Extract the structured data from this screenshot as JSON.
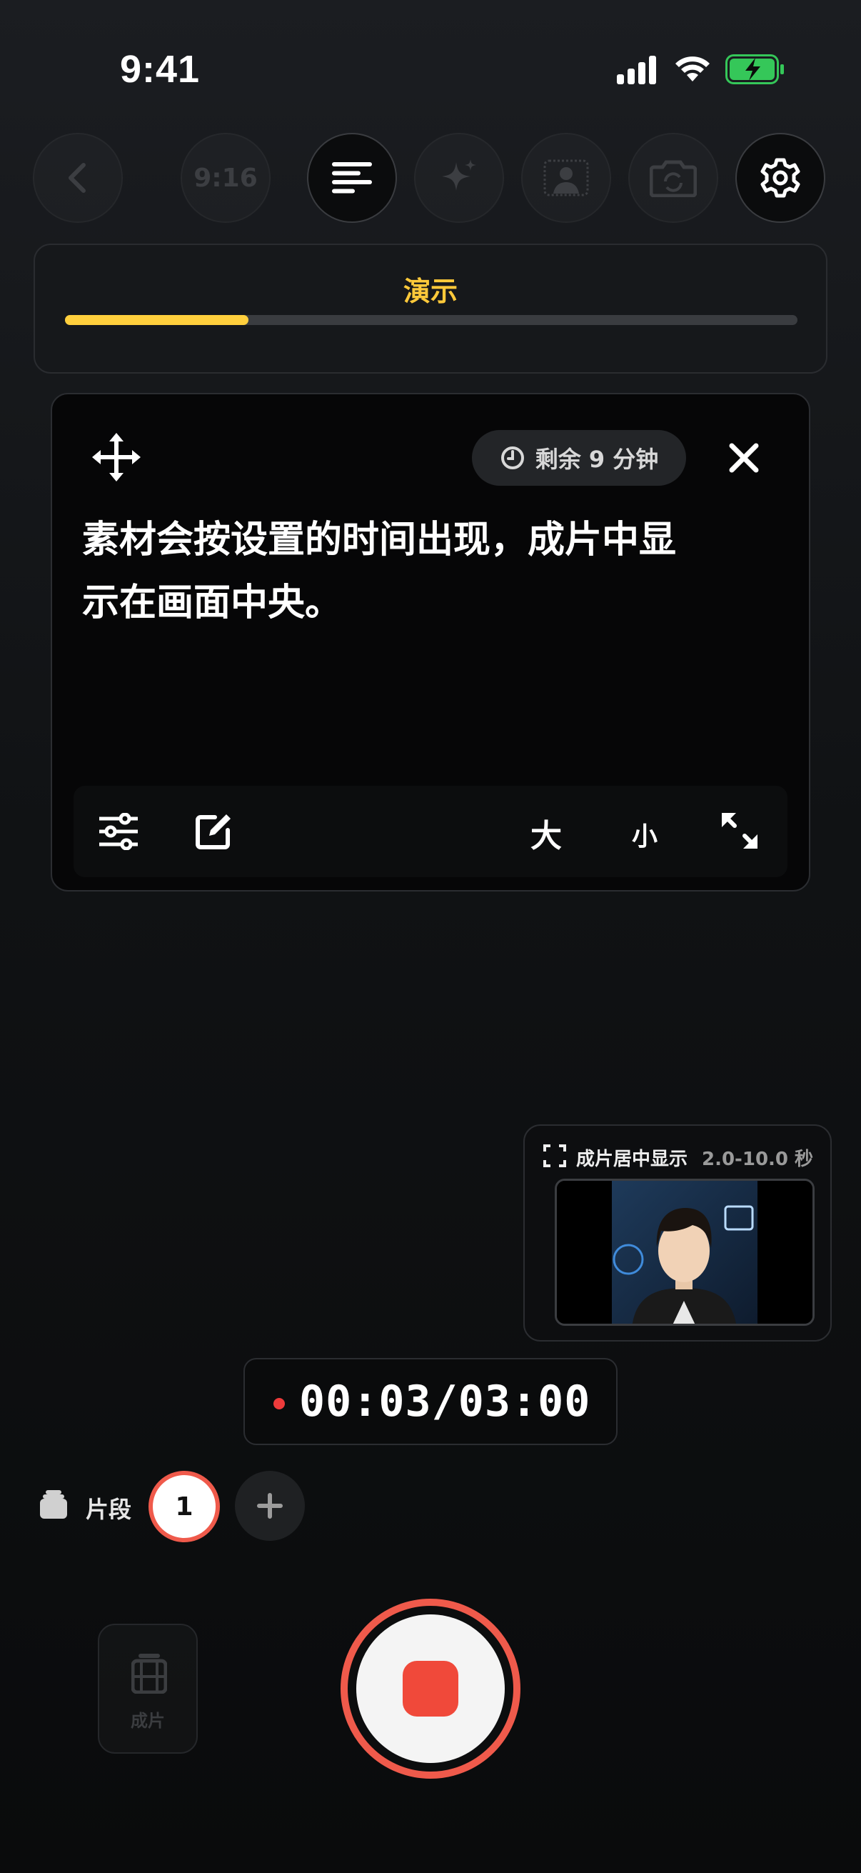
{
  "status_bar": {
    "time": "9:41"
  },
  "toolbar": {
    "aspect_label": "9:16",
    "items": [
      "back",
      "aspect",
      "text",
      "beautify",
      "background",
      "flip-camera",
      "settings"
    ]
  },
  "demo": {
    "title": "演示",
    "progress": 0.25
  },
  "prompter": {
    "remaining": "剩余 9 分钟",
    "text_line1": "素材会按设置的时间出现，成片中显",
    "text_line2": "示在画面中央。",
    "font_large": "大",
    "font_small": "小"
  },
  "preview": {
    "label": "成片居中显示",
    "range": "2.0-10.0 秒"
  },
  "recording": {
    "elapsed": "00:03/03:00"
  },
  "segments": {
    "label": "片段",
    "items": [
      "1"
    ]
  },
  "film": {
    "label": "成片"
  },
  "colors": {
    "accent": "#ffc93a",
    "record": "#ef5a4b",
    "stop": "#f0493a"
  }
}
